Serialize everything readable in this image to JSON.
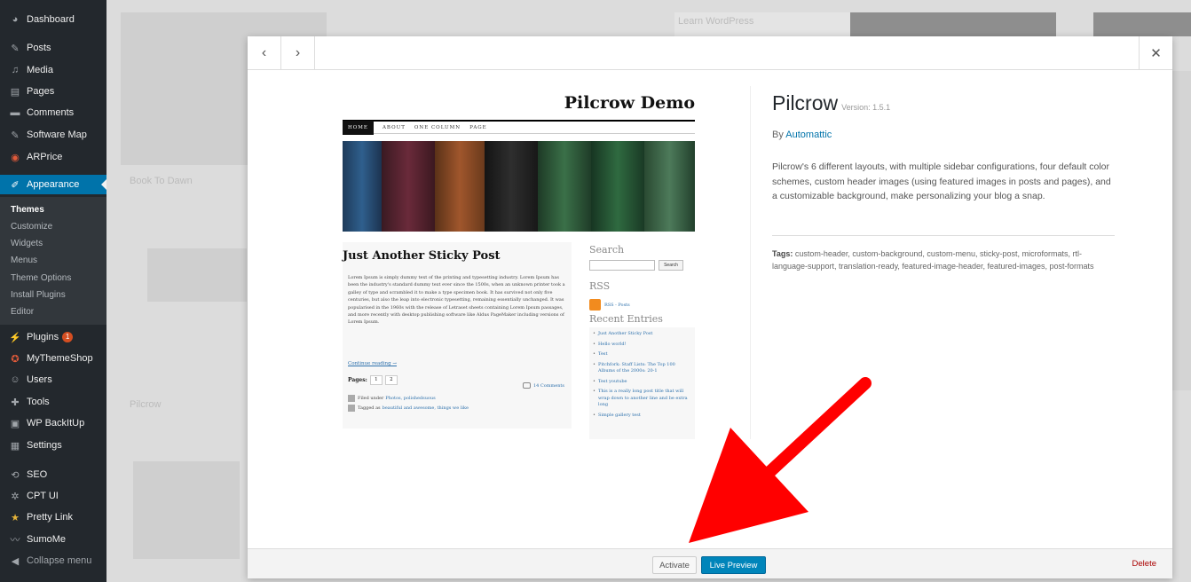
{
  "sidebar": {
    "items": [
      {
        "label": "Dashboard",
        "icon": "dashboard-icon"
      },
      {
        "label": "Posts",
        "icon": "pin-icon"
      },
      {
        "label": "Media",
        "icon": "media-icon"
      },
      {
        "label": "Pages",
        "icon": "pages-icon"
      },
      {
        "label": "Comments",
        "icon": "comments-icon"
      },
      {
        "label": "Software Map",
        "icon": "pin-icon"
      },
      {
        "label": "ARPrice",
        "icon": "arprice-icon"
      },
      {
        "label": "Appearance",
        "icon": "brush-icon"
      },
      {
        "label": "Plugins",
        "icon": "plugin-icon",
        "badge": "1"
      },
      {
        "label": "MyThemeShop",
        "icon": "mythemeshop-icon"
      },
      {
        "label": "Users",
        "icon": "users-icon"
      },
      {
        "label": "Tools",
        "icon": "wrench-icon"
      },
      {
        "label": "WP BackItUp",
        "icon": "backup-icon"
      },
      {
        "label": "Settings",
        "icon": "settings-icon"
      },
      {
        "label": "SEO",
        "icon": "seo-icon"
      },
      {
        "label": "CPT UI",
        "icon": "gear-icon"
      },
      {
        "label": "Pretty Link",
        "icon": "star-icon"
      },
      {
        "label": "SumoMe",
        "icon": "sumome-icon"
      },
      {
        "label": "Collapse menu",
        "icon": "collapse-icon"
      }
    ],
    "submenu": [
      "Themes",
      "Customize",
      "Widgets",
      "Menus",
      "Theme Options",
      "Install Plugins",
      "Editor"
    ]
  },
  "background": {
    "texts": [
      "Learn WordPress",
      "Book To Dawn",
      "Pilcrow"
    ]
  },
  "modal": {
    "prev_icon": "‹",
    "next_icon": "›",
    "close_icon": "✕",
    "preview": {
      "site_title": "Pilcrow Demo",
      "nav": [
        "HOME",
        "ABOUT",
        "ONE COLUMN",
        "PAGE"
      ],
      "post_title": "Just Another Sticky Post",
      "post_body": "Lorem Ipsum is simply dummy text of the printing and typesetting industry. Lorem Ipsum has been the industry's standard dummy text ever since the 1500s, when an unknown printer took a galley of type and scrambled it to make a type specimen book. It has survived not only five centuries, but also the leap into electronic typesetting, remaining essentially unchanged. It was popularised in the 1960s with the release of Letraset sheets containing Lorem Ipsum passages, and more recently with desktop publishing software like Aldus PageMaker including versions of Lorem Ipsum.",
      "continue": "Continue reading →",
      "pages_label": "Pages:",
      "pages": [
        "1",
        "2"
      ],
      "filed_under": "Filed under",
      "filed_links": "Photos, polishedsuous",
      "tagged": "Tagged as",
      "tagged_links": "beautiful and awesome, things we like",
      "comments": "14 Comments",
      "search_heading": "Search",
      "search_button": "Search",
      "rss_heading": "RSS",
      "rss_posts": "RSS - Posts",
      "recent_heading": "Recent Entries",
      "recent_entries": [
        "Just Another Sticky Post",
        "Hello world!",
        "Test",
        "Pitchfork: Staff Lists: The Top 100 Albums of the 2000s: 20-1",
        "Test youtube",
        "This is a really long post title that will wrap down to another line and be extra long",
        "Simple gallery test"
      ]
    },
    "theme": {
      "name": "Pilcrow",
      "version": "Version: 1.5.1",
      "by": "By",
      "author": "Automattic",
      "description": "Pilcrow's 6 different layouts, with multiple sidebar configurations, four default color schemes, custom header images (using featured images in posts and pages), and a customizable background, make personalizing your blog a snap.",
      "tags_label": "Tags:",
      "tags": "custom-header, custom-background, custom-menu, sticky-post, microformats, rtl-language-support, translation-ready, featured-image-header, featured-images, post-formats"
    },
    "footer": {
      "activate": "Activate",
      "live_preview": "Live Preview",
      "delete": "Delete"
    }
  },
  "colors": {
    "sidebar_bg": "#23282d",
    "accent": "#0073aa",
    "button_primary": "#0085ba",
    "delete": "#aa0000",
    "arrow": "#ff0000"
  }
}
